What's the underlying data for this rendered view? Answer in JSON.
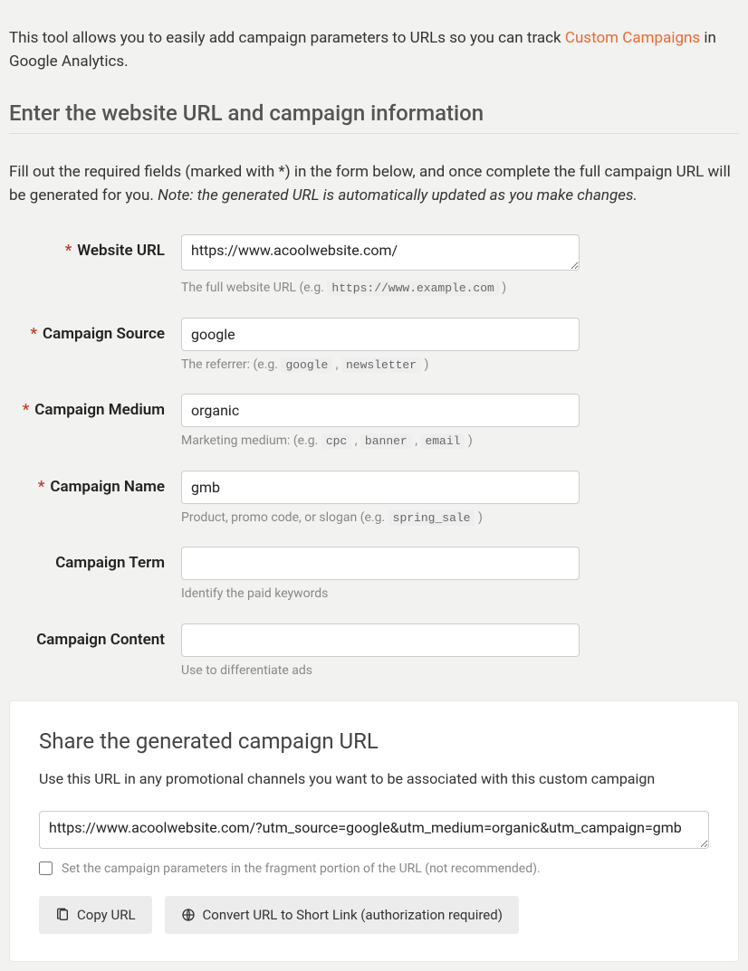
{
  "intro": {
    "pre": "This tool allows you to easily add campaign parameters to URLs so you can track ",
    "link": "Custom Campaigns",
    "post": " in Google Analytics."
  },
  "heading": "Enter the website URL and campaign information",
  "instructions": {
    "text": "Fill out the required fields (marked with *) in the form below, and once complete the full campaign URL will be generated for you. ",
    "note": "Note: the generated URL is automatically updated as you make changes."
  },
  "fields": {
    "url": {
      "label": "Website URL",
      "value": "https://www.acoolwebsite.com/",
      "help_pre": "The full website URL (e.g. ",
      "help_code": "https://www.example.com",
      "help_post": " )",
      "required": true
    },
    "source": {
      "label": "Campaign Source",
      "value": "google",
      "help_pre": "The referrer: (e.g. ",
      "help_code1": "google",
      "help_sep": " , ",
      "help_code2": "newsletter",
      "help_post": " )",
      "required": true
    },
    "medium": {
      "label": "Campaign Medium",
      "value": "organic",
      "help_pre": "Marketing medium: (e.g. ",
      "help_code1": "cpc",
      "help_code2": "banner",
      "help_code3": "email",
      "help_sep": " , ",
      "help_post": " )",
      "required": true
    },
    "name": {
      "label": "Campaign Name",
      "value": "gmb",
      "help_pre": "Product, promo code, or slogan (e.g. ",
      "help_code": "spring_sale",
      "help_post": " )",
      "required": true
    },
    "term": {
      "label": "Campaign Term",
      "value": "",
      "help": "Identify the paid keywords",
      "required": false
    },
    "content": {
      "label": "Campaign Content",
      "value": "",
      "help": "Use to differentiate ads",
      "required": false
    }
  },
  "share": {
    "heading": "Share the generated campaign URL",
    "desc": "Use this URL in any promotional channels you want to be associated with this custom campaign",
    "url": "https://www.acoolwebsite.com/?utm_source=google&utm_medium=organic&utm_campaign=gmb",
    "fragment_label": "Set the campaign parameters in the fragment portion of the URL (not recommended).",
    "copy_label": "Copy URL",
    "convert_label": "Convert URL to Short Link (authorization required)"
  }
}
